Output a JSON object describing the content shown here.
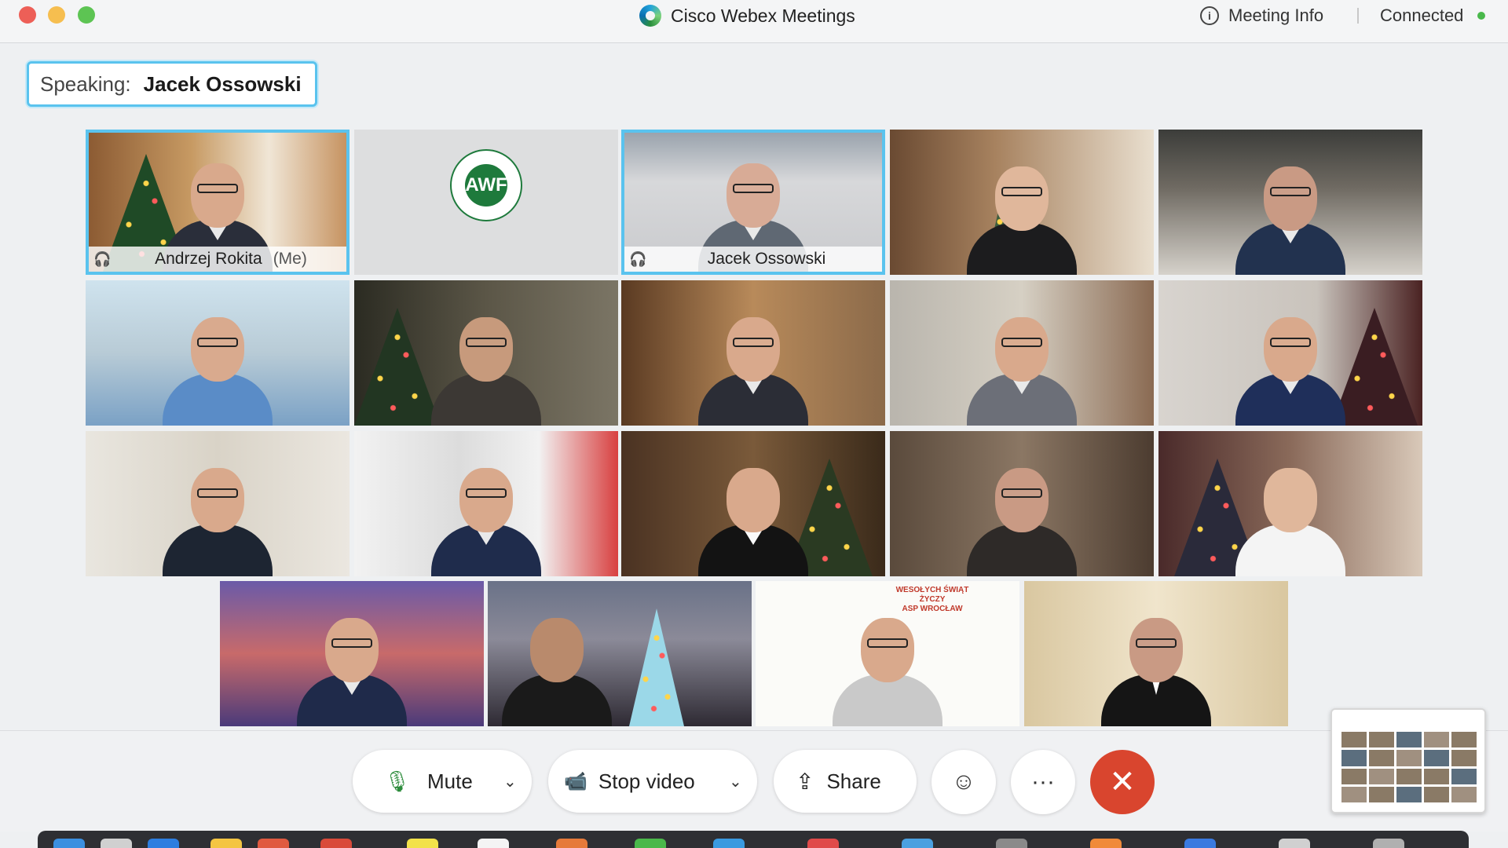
{
  "window": {
    "app_title": "Cisco Webex Meetings",
    "meeting_info_label": "Meeting Info",
    "connection_status": "Connected"
  },
  "speaking": {
    "prefix": "Speaking:",
    "name": "Jacek Ossowski"
  },
  "participants": [
    {
      "name": "Andrzej Rokita",
      "suffix": "(Me)",
      "active": true
    },
    {
      "name": "",
      "logo": "university-logo"
    },
    {
      "name": "Jacek Ossowski",
      "active": true
    },
    {
      "name": ""
    },
    {
      "name": ""
    },
    {
      "name": ""
    },
    {
      "name": ""
    },
    {
      "name": ""
    },
    {
      "name": ""
    },
    {
      "name": ""
    },
    {
      "name": ""
    },
    {
      "name": ""
    },
    {
      "name": ""
    },
    {
      "name": ""
    },
    {
      "name": ""
    },
    {
      "name": ""
    },
    {
      "name": ""
    },
    {
      "name": ""
    },
    {
      "name": ""
    }
  ],
  "tile_texts": {
    "greeting_line1": "WESOŁYCH ŚWIĄT",
    "greeting_line2": "ŻYCZY",
    "greeting_line3": "ASP WROCŁAW"
  },
  "controls": {
    "mute_label": "Mute",
    "stop_video_label": "Stop video",
    "share_label": "Share",
    "more_label": "···",
    "end_label": "✕"
  },
  "icons": {
    "mic": "microphone-icon",
    "video": "video-camera-icon",
    "share": "share-upload-icon",
    "reactions": "smiley-reactions-icon",
    "end": "close-x-icon"
  },
  "colors": {
    "active_border": "#5ac3ee",
    "end_button": "#d9452e",
    "connected_dot": "#49b84b"
  }
}
